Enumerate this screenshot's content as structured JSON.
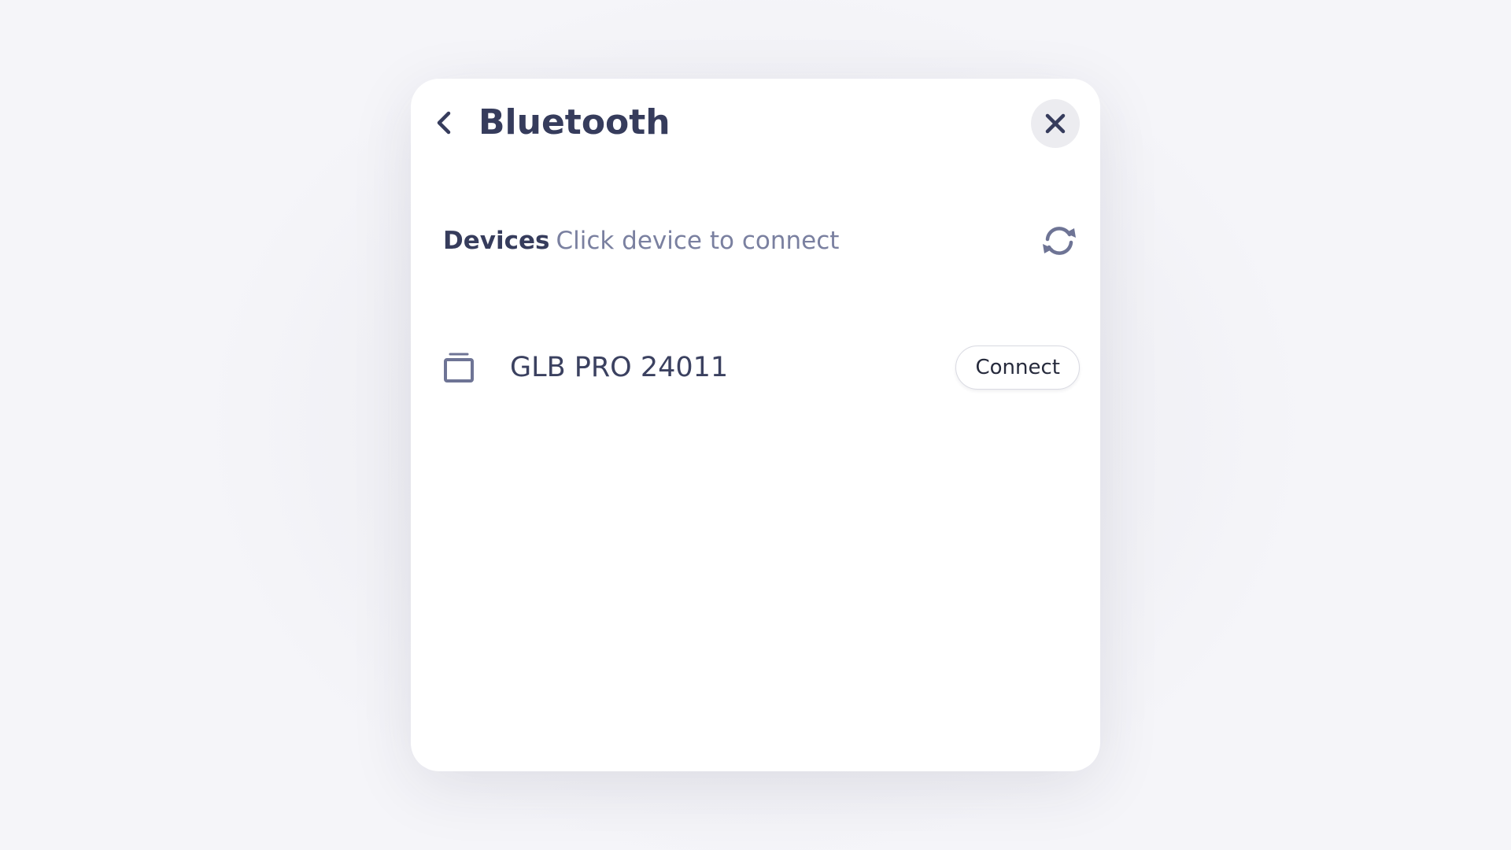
{
  "dialog": {
    "title": "Bluetooth",
    "back_icon": "chevron-left-icon",
    "close_icon": "close-icon"
  },
  "devices_section": {
    "label": "Devices",
    "hint": "Click device to connect",
    "refresh_icon": "refresh-icon"
  },
  "device_list": [
    {
      "name": "GLB PRO 24011",
      "icon": "device-icon",
      "action_label": "Connect"
    }
  ],
  "colors": {
    "title_text": "#363c5c",
    "hint_text": "#7a80a0",
    "icon": "#6e7495",
    "panel_bg": "#ffffff",
    "page_bg": "#f5f5f9",
    "close_bg": "#ececf0"
  }
}
